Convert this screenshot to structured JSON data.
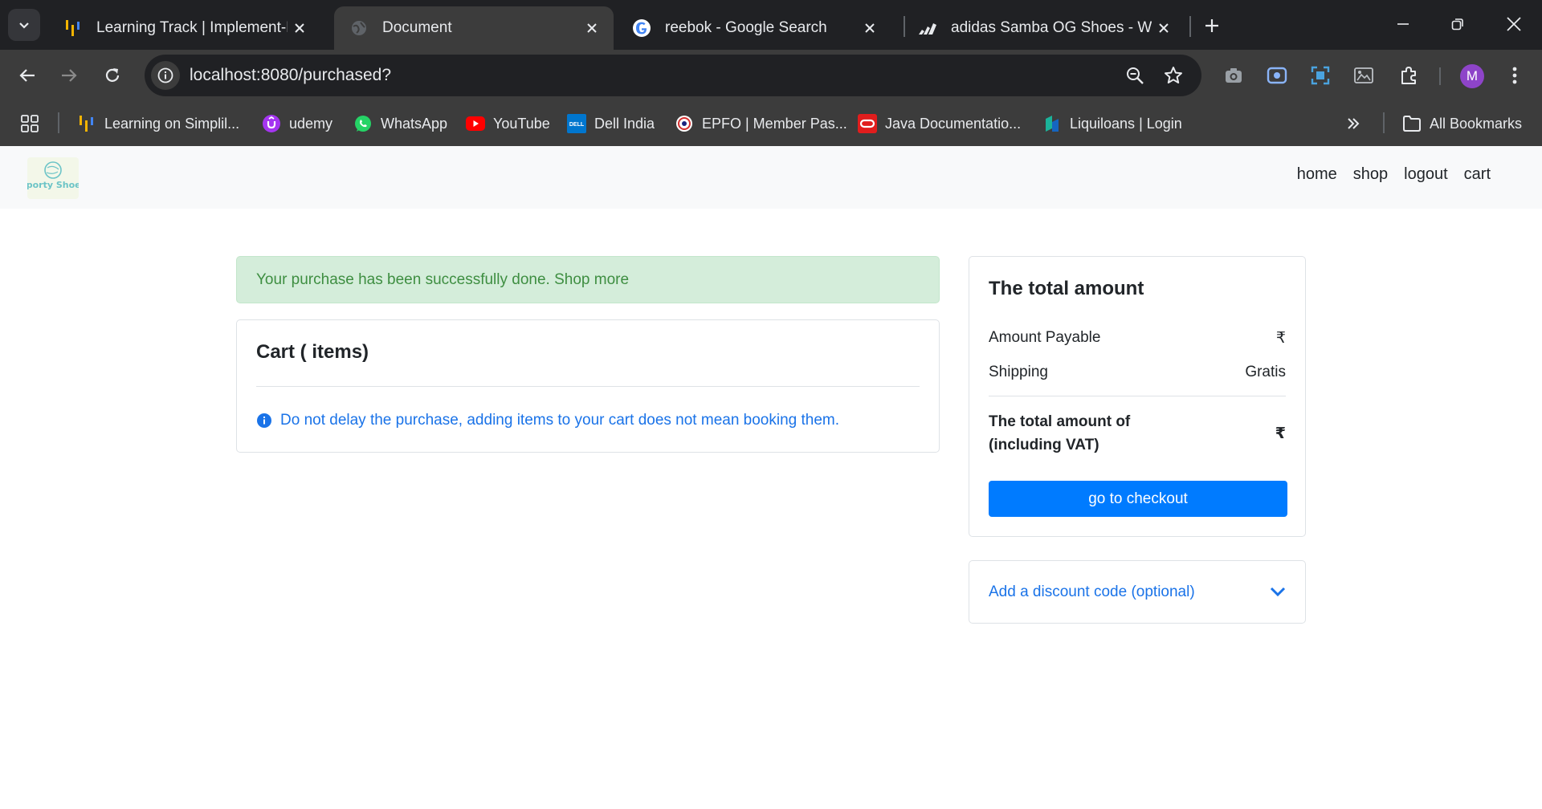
{
  "browser": {
    "tabs": [
      {
        "title": "Learning Track | Implement-Fra",
        "icon": "simplilearn-icon"
      },
      {
        "title": "Document",
        "icon": "globe-icon",
        "active": true
      },
      {
        "title": "reebok - Google Search",
        "icon": "google-icon"
      },
      {
        "title": "adidas Samba OG Shoes - Whit",
        "icon": "adidas-icon"
      }
    ],
    "url": "localhost:8080/purchased?",
    "avatar_letter": "M",
    "bookmarks": [
      {
        "label": "Learning on Simplil...",
        "icon": "simplilearn-icon"
      },
      {
        "label": "udemy",
        "icon": "udemy-icon"
      },
      {
        "label": "WhatsApp",
        "icon": "whatsapp-icon"
      },
      {
        "label": "YouTube",
        "icon": "youtube-icon"
      },
      {
        "label": "Dell India",
        "icon": "dell-icon"
      },
      {
        "label": "EPFO | Member Pas...",
        "icon": "epfo-icon"
      },
      {
        "label": "Java Documentatio...",
        "icon": "oracle-icon"
      },
      {
        "label": "Liquiloans | Login",
        "icon": "liquiloans-icon"
      }
    ],
    "all_bookmarks_label": "All Bookmarks"
  },
  "site": {
    "logo_text": "Sporty Shoes",
    "nav": [
      "home",
      "shop",
      "logout",
      "cart"
    ]
  },
  "alert": {
    "text": "Your purchase has been successfully done. Shop more"
  },
  "cart": {
    "title": "Cart ( items)",
    "note": "Do not delay the purchase, adding items to your cart does not mean booking them."
  },
  "summary": {
    "title": "The total amount",
    "amount_payable_label": "Amount Payable",
    "amount_payable_value": "₹",
    "shipping_label": "Shipping",
    "shipping_value": "Gratis",
    "total_label": "The total amount of (including VAT)",
    "total_value": "₹",
    "checkout_label": "go to checkout"
  },
  "discount": {
    "label": "Add a discount code (optional)"
  },
  "colors": {
    "primary": "#007bff",
    "link": "#1a73e8",
    "success_bg": "#d4edda",
    "success_text": "#3e8e41",
    "chrome_dark": "#202124",
    "chrome_toolbar": "#3c3c3c"
  }
}
